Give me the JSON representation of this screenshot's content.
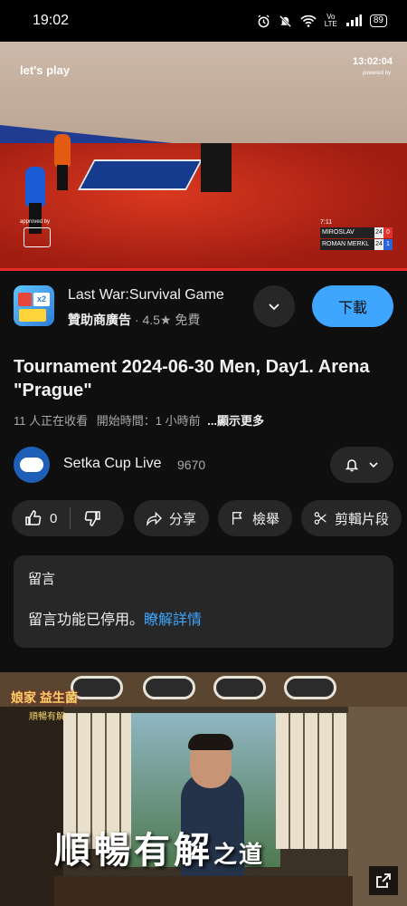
{
  "status_bar": {
    "time": "19:02",
    "battery": "89",
    "volte_top": "Vo",
    "volte_bottom": "LTE"
  },
  "video": {
    "overlay_left": "let's play",
    "clock": "13:02:04",
    "powered_by": "powered by",
    "approved_by": "approved by",
    "scoreboard": {
      "set_label": "7:11",
      "players": [
        {
          "name": "MIROSLAV HAJEK",
          "games": "24",
          "points": "0",
          "points_color": "#e0322a"
        },
        {
          "name": "ROMAN MERKL",
          "games": "24",
          "points": "1",
          "points_color": "#2a62d8"
        }
      ]
    },
    "progress_fraction": 1.0
  },
  "ad": {
    "title": "Last War:Survival Game",
    "sponsored": "贊助商廣告",
    "rating": "· 4.5★",
    "price": "免費",
    "download_label": "下載",
    "icon_text": "x2"
  },
  "video_info": {
    "title": "Tournament 2024-06-30 Men, Day1. Arena \"Prague\"",
    "watching": "11 人正在收看",
    "started": "開始時間：1 小時前",
    "more": "...顯示更多"
  },
  "channel": {
    "name": "Setka Cup Live",
    "subscribers": "9670"
  },
  "actions": {
    "like_count": "0",
    "share": "分享",
    "report": "檢舉",
    "clip": "剪輯片段"
  },
  "comments": {
    "header": "留言",
    "disabled_text": "留言功能已停用。",
    "learn_more": "瞭解詳情"
  },
  "bottom_ad": {
    "brand": "娘家",
    "brand_sub": "順暢有解",
    "brand_tag": "益生菌",
    "slogan": "順暢有解",
    "slogan_small": "之道"
  },
  "colors": {
    "background": "#0f0f0f",
    "accent_blue": "#3ea6ff",
    "chip": "#272727",
    "progress": "#e52d27"
  }
}
